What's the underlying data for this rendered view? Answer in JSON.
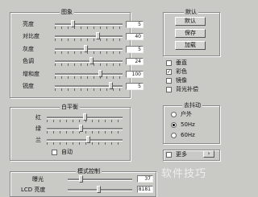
{
  "image_group": {
    "title": "图象",
    "rows": [
      {
        "label": "亮度",
        "value": "5",
        "pos": 0.25
      },
      {
        "label": "对比度",
        "value": "40",
        "pos": 0.65
      },
      {
        "label": "灰度",
        "value": "5",
        "pos": 0.45
      },
      {
        "label": "色调",
        "value": "24",
        "pos": 0.55
      },
      {
        "label": "增和度",
        "value": "100",
        "pos": 0.68
      },
      {
        "label": "锐度",
        "value": "5",
        "pos": 0.85
      }
    ]
  },
  "defaults_group": {
    "title": "默认",
    "buttons": [
      "默认",
      "保存",
      "加载"
    ]
  },
  "options": [
    {
      "label": "垂直",
      "checked": false
    },
    {
      "label": "彩色",
      "checked": true
    },
    {
      "label": "镜像",
      "checked": false
    },
    {
      "label": "背光补偿",
      "checked": false
    }
  ],
  "white_balance": {
    "title": "白平衡",
    "rows": [
      {
        "label": "红",
        "pos": 0.5
      },
      {
        "label": "绿",
        "pos": 0.45
      },
      {
        "label": "兰",
        "pos": 0.55
      }
    ],
    "auto_label": "自动"
  },
  "flicker": {
    "title": "去抖动",
    "options": [
      {
        "label": "户外",
        "selected": false
      },
      {
        "label": "50Hz",
        "selected": true
      },
      {
        "label": "60Hz",
        "selected": false
      }
    ]
  },
  "mode_control": {
    "title": "模式控制",
    "rows": [
      {
        "label": "曝光",
        "value": "37"
      },
      {
        "label": "LCD 亮度",
        "value": "8181"
      }
    ]
  },
  "extra_checkbox": {
    "label": "更多"
  },
  "watermark": "软件技巧"
}
